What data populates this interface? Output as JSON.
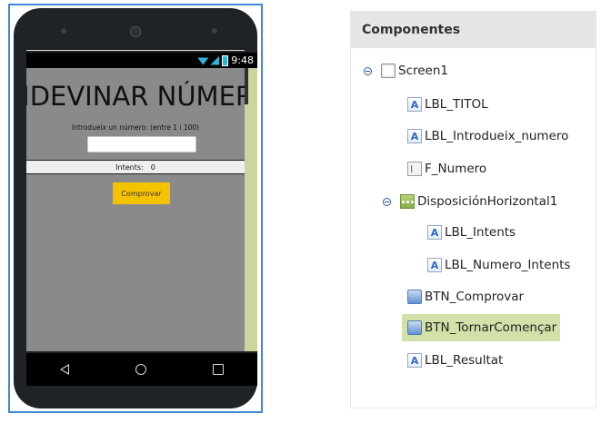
{
  "phone": {
    "status_time": "9:48",
    "screen": {
      "title": "NDEVINAR NÚMERO",
      "prompt": "Introdueix un número: (entre 1 i 100)",
      "number_value": "",
      "intents_label": "Intents:",
      "intents_value": "0",
      "check_button": "Comprovar"
    }
  },
  "panel": {
    "header": "Componentes",
    "tree": [
      {
        "label": "Screen1",
        "icon": "screen-icon",
        "toggle": true
      },
      {
        "label": "LBL_TITOL",
        "icon": "label-icon"
      },
      {
        "label": "LBL_Introdueix_numero",
        "icon": "label-icon"
      },
      {
        "label": "F_Numero",
        "icon": "textbox-icon"
      },
      {
        "label": "DisposiciónHorizontal1",
        "icon": "horizontal-arrangement-icon",
        "toggle": true
      },
      {
        "label": "LBL_Intents",
        "icon": "label-icon"
      },
      {
        "label": "LBL_Numero_Intents",
        "icon": "label-icon"
      },
      {
        "label": "BTN_Comprovar",
        "icon": "button-icon"
      },
      {
        "label": "BTN_TornarComençar",
        "icon": "button-icon",
        "selected": true
      },
      {
        "label": "LBL_Resultat",
        "icon": "label-icon"
      }
    ]
  },
  "colors": {
    "screen_bg": "#8a8a8a",
    "button_yellow": "#f5c200",
    "selected_row": "#d1e1a8",
    "frame_border": "#3f89d6"
  }
}
